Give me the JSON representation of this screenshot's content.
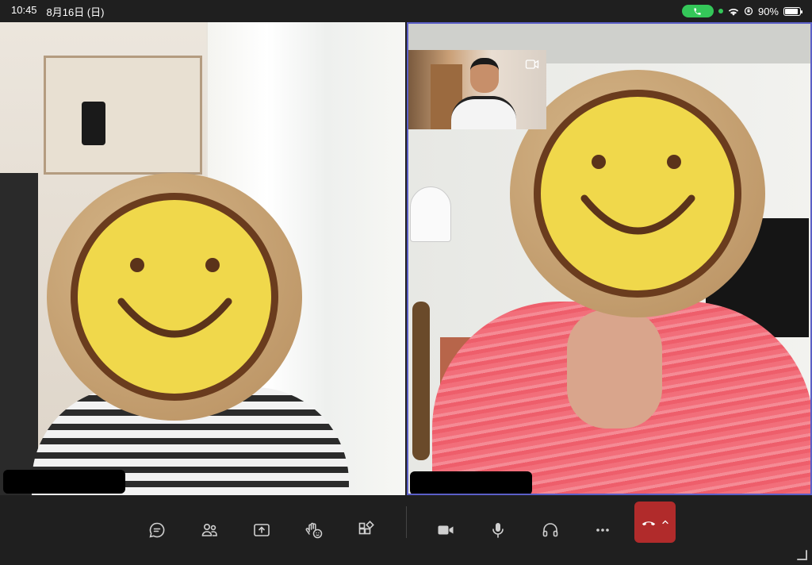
{
  "status_bar": {
    "time": "10:45",
    "date": "8月16日 (日)",
    "battery": "90%",
    "battery_level": 0.9,
    "call_indicator_color": "#34c759"
  },
  "participants": [
    {
      "id": "left",
      "name": "",
      "speaking": false
    },
    {
      "id": "right",
      "name": "",
      "speaking": true
    }
  ],
  "controls": [
    {
      "name": "chat-icon"
    },
    {
      "name": "people-icon"
    },
    {
      "name": "share-screen-icon"
    },
    {
      "name": "reactions-icon"
    },
    {
      "name": "apps-icon"
    },
    {
      "name": "camera-icon"
    },
    {
      "name": "microphone-icon"
    },
    {
      "name": "audio-device-icon"
    },
    {
      "name": "more-options-icon"
    },
    {
      "name": "hang-up-icon"
    }
  ],
  "colors": {
    "active_speaker_border": "#5b5fc7",
    "hangup": "#b12b2b",
    "background": "#1f1f1f"
  }
}
